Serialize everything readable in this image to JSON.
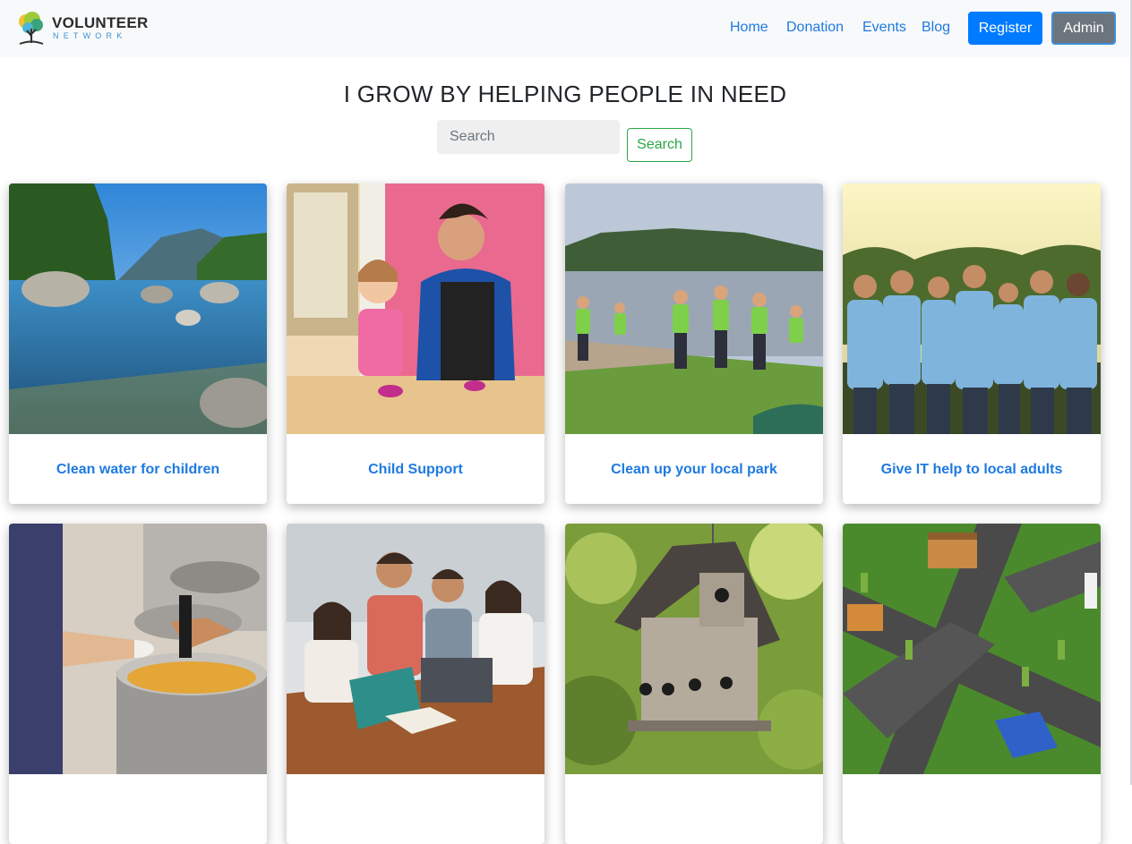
{
  "brand": {
    "line1": "VOLUNTEER",
    "line2": "NETWORK"
  },
  "nav": {
    "links": [
      "Home",
      "Donation",
      "Events",
      "Blog"
    ],
    "register_label": "Register",
    "admin_label": "Admin"
  },
  "hero": {
    "headline": "I GROW BY HELPING PEOPLE IN NEED",
    "search_placeholder": "Search",
    "search_button": "Search"
  },
  "cards": [
    {
      "title": "Clean water for children",
      "image": "river-landscape"
    },
    {
      "title": "Child Support",
      "image": "child-playing-clay"
    },
    {
      "title": "Clean up your local park",
      "image": "volunteers-lakeside"
    },
    {
      "title": "Give IT help to local adults",
      "image": "volunteer-group-photo"
    },
    {
      "title": "",
      "image": "food-serving-pot"
    },
    {
      "title": "",
      "image": "people-studying-books"
    },
    {
      "title": "",
      "image": "wooden-birdhouse"
    },
    {
      "title": "",
      "image": "city-intersection-model"
    }
  ],
  "colors": {
    "link": "#1e7ae0",
    "primary": "#007bff",
    "secondary": "#6c757d",
    "success": "#28a745",
    "navbar_bg": "#f8f9fa"
  }
}
